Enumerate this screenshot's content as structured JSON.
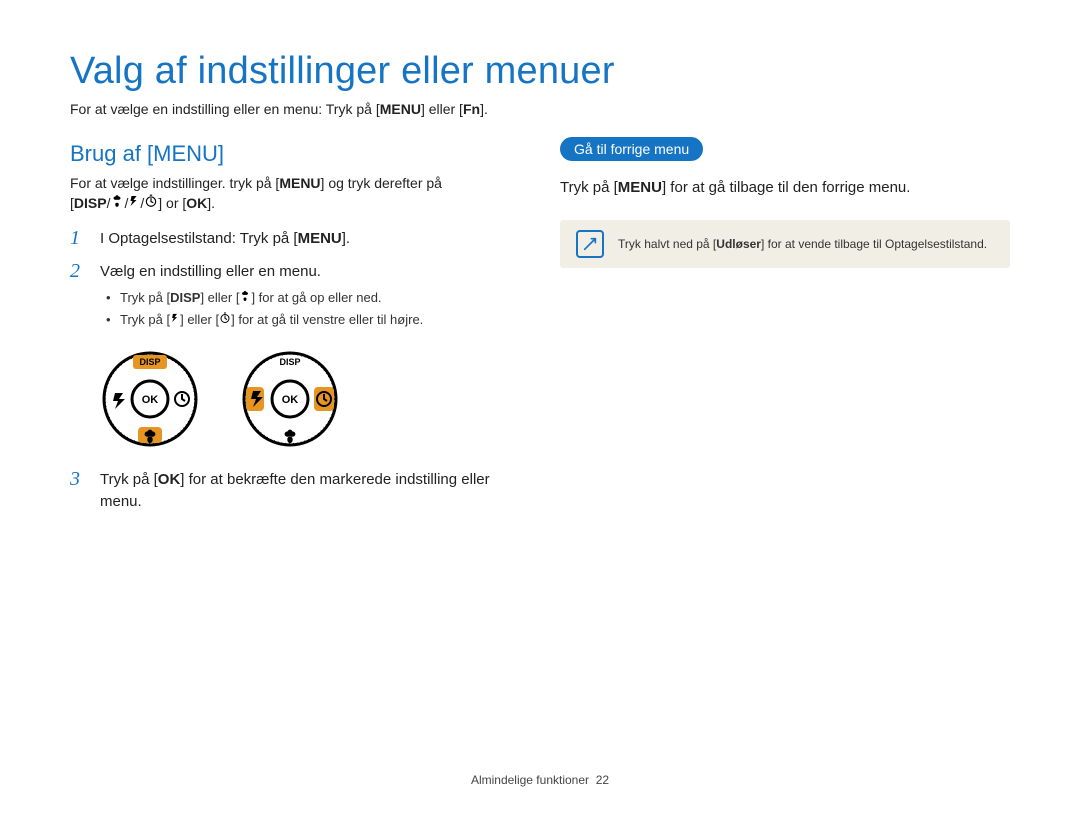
{
  "title": "Valg af indstillinger eller menuer",
  "intro": {
    "prefix": "For at vælge en indstilling eller en menu: Tryk på [",
    "menu": "MENU",
    "mid": "] eller [",
    "fn": "Fn",
    "suffix": "]."
  },
  "left": {
    "heading": "Brug af [MENU]",
    "sub": {
      "prefix": "For at vælge indstillinger. tryk på [",
      "menu": "MENU",
      "suffix": "] og tryk derefter på"
    },
    "sub2": {
      "disp": "DISP",
      "or_text": " or ",
      "ok": "OK",
      "end": "]."
    },
    "steps": {
      "s1_prefix": "I Optagelsestilstand: Tryk på [",
      "s1_menu": "MENU",
      "s1_suffix": "].",
      "s2": "Vælg en indstilling eller en menu.",
      "s2b1_prefix": "Tryk på [",
      "s2b1_disp": "DISP",
      "s2b1_mid": "] eller [",
      "s2b1_suffix": "] for at gå op eller ned.",
      "s2b2_prefix": "Tryk på [",
      "s2b2_mid": "] eller [",
      "s2b2_suffix": "] for at gå til venstre eller til højre.",
      "s3_prefix": "Tryk på [",
      "s3_ok": "OK",
      "s3_suffix": "] for at bekræfte den markerede indstilling eller menu."
    },
    "dial": {
      "disp": "DISP",
      "ok": "OK"
    }
  },
  "right": {
    "pill": "Gå til forrige menu",
    "line_prefix": "Tryk på [",
    "line_menu": "MENU",
    "line_suffix": "] for at gå tilbage til den forrige menu.",
    "note_prefix": "Tryk halvt ned på [",
    "note_bold": "Udløser",
    "note_suffix": "] for at vende tilbage til Optagelsestilstand."
  },
  "footer": {
    "text": "Almindelige funktioner",
    "page": "22"
  }
}
